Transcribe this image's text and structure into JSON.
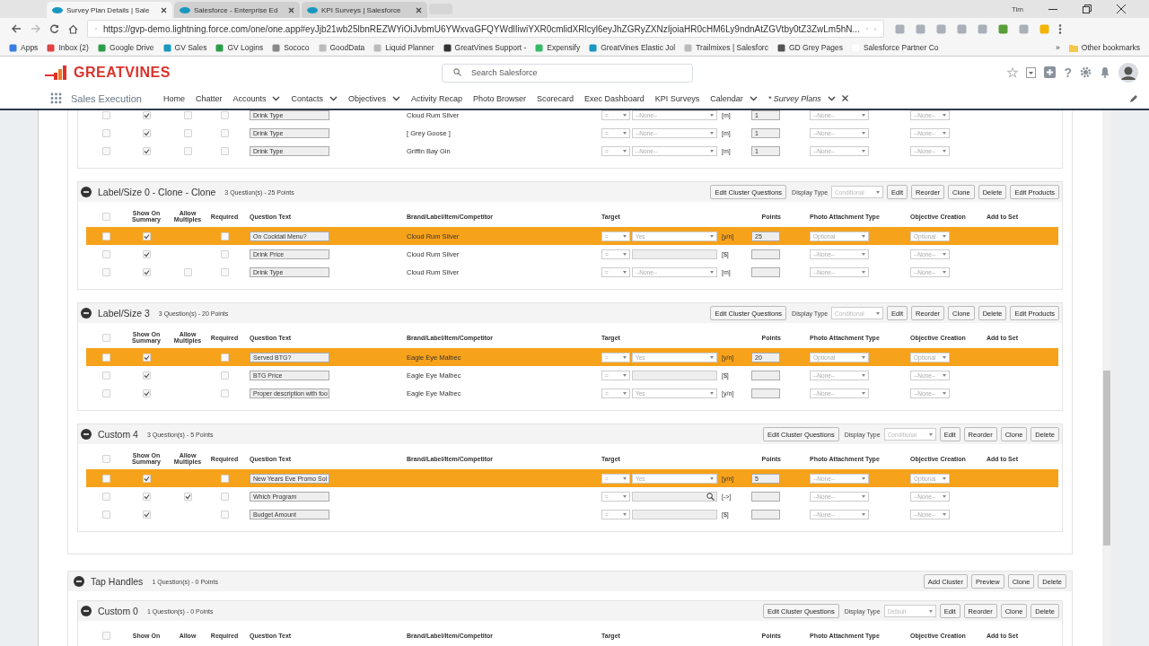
{
  "browser": {
    "tabs": [
      {
        "title": "Survey Plan Details | Sale",
        "selected": true
      },
      {
        "title": "Salesforce - Enterprise Ed",
        "selected": false
      },
      {
        "title": "KPI Surveys | Salesforce",
        "selected": false
      }
    ],
    "profile": "Tim",
    "url": "https://gvp-demo.lightning.force.com/one/one.app#eyJjb21wb25lbnREZWYiOiJvbmU6YWxvaGFQYWdlIiwiYXR0cmlidXRlcyl6eyJhZGRyZXNzIjoiaHR0cHM6Ly9ndnAtZGVtby0tZ3ZwLm5hN...",
    "bookmarks": [
      "Apps",
      "Inbox (2)",
      "Google Drive",
      "GV Sales",
      "GV Logins",
      "Sococo",
      "GoodData",
      "Liquid Planner",
      "GreatVines Support -",
      "Expensify",
      "GreatVines Elastic Jol",
      "Trailmixes | Salesforc",
      "GD Grey Pages",
      "Salesforce Partner Co"
    ],
    "more_bookmarks": "»",
    "other_bookmarks": "Other bookmarks"
  },
  "app": {
    "logo": "GREATVINES",
    "search": {
      "placeholder": "Search Salesforce"
    },
    "help": "?",
    "app_name": "Sales Execution",
    "nav": [
      {
        "label": "Home",
        "has_menu": false,
        "selected": false
      },
      {
        "label": "Chatter",
        "has_menu": false,
        "selected": false
      },
      {
        "label": "Accounts",
        "has_menu": true,
        "selected": false
      },
      {
        "label": "Contacts",
        "has_menu": true,
        "selected": false
      },
      {
        "label": "Objectives",
        "has_menu": true,
        "selected": false
      },
      {
        "label": "Activity Recap",
        "has_menu": false,
        "selected": false
      },
      {
        "label": "Photo Browser",
        "has_menu": false,
        "selected": false
      },
      {
        "label": "Scorecard",
        "has_menu": false,
        "selected": false
      },
      {
        "label": "Exec Dashboard",
        "has_menu": false,
        "selected": false
      },
      {
        "label": "KPI Surveys",
        "has_menu": false,
        "selected": false
      },
      {
        "label": "Calendar",
        "has_menu": true,
        "selected": false
      },
      {
        "label": "* Survey Plans",
        "has_menu": true,
        "selected": true
      }
    ]
  },
  "groups": [
    {
      "clusters": [
        {
          "rows": [
            {
              "highlighted": false,
              "show_on_summary": true,
              "allow_multiples": false,
              "required": false,
              "question": "Drink Type",
              "brand": "Cloud Rum Silver",
              "operator": "=",
              "kind": "select",
              "target_value": "--None--",
              "unit": "[m]",
              "points": "1",
              "photo": "--None--",
              "objective": "--None--"
            },
            {
              "highlighted": false,
              "show_on_summary": true,
              "allow_multiples": false,
              "required": false,
              "question": "Drink Type",
              "brand": "[ Grey Goose ]",
              "operator": "=",
              "kind": "select",
              "target_value": "--None--",
              "unit": "[m]",
              "points": "1",
              "photo": "--None--",
              "objective": "--None--"
            },
            {
              "highlighted": false,
              "show_on_summary": true,
              "allow_multiples": false,
              "required": false,
              "question": "Drink Type",
              "brand": "Griffin Bay Gin",
              "operator": "=",
              "kind": "select",
              "target_value": "--None--",
              "unit": "[m]",
              "points": "1",
              "photo": "--None--",
              "objective": "--None--"
            }
          ]
        },
        {
          "title": "Label/Size 0 - Clone - Clone",
          "summary": "3 Question(s) - 25 Points",
          "edit_button": "Edit Cluster Questions",
          "display_type": {
            "label": "Display Type",
            "value": "Conditional"
          },
          "buttons": [
            "Edit",
            "Reorder",
            "Clone",
            "Delete",
            "Edit Products"
          ],
          "all_selected": false,
          "columns": [
            "Show On Summary",
            "Allow Multiples",
            "Required",
            "Question Text",
            "Brand/Label/Item/Competitor",
            "Target",
            "Points",
            "Photo Attachment Type",
            "Objective Creation",
            "Add to Set"
          ],
          "rows": [
            {
              "highlighted": true,
              "show_on_summary": true,
              "required": false,
              "question": "On Cocktail Menu?",
              "brand": "Cloud Rum Silver",
              "operator": "=",
              "kind": "select",
              "target_value": "Yes",
              "unit": "[y/n]",
              "points": "25",
              "photo": "Optional",
              "objective": "Optional"
            },
            {
              "highlighted": false,
              "show_on_summary": true,
              "required": false,
              "question": "Drink Price",
              "brand": "Cloud Rum Silver",
              "operator": "=",
              "kind": "text",
              "unit": "[$]",
              "photo": "--None--",
              "objective": "--None--"
            },
            {
              "highlighted": false,
              "show_on_summary": true,
              "allow_multiples": false,
              "required": false,
              "question": "Drink Type",
              "brand": "Cloud Rum Silver",
              "operator": "=",
              "kind": "select",
              "target_value": "--None--",
              "unit": "[m]",
              "photo": "--None--",
              "objective": "--None--"
            }
          ]
        },
        {
          "title": "Label/Size 3",
          "summary": "3 Question(s) - 20 Points",
          "edit_button": "Edit Cluster Questions",
          "display_type": {
            "label": "Display Type",
            "value": "Conditional"
          },
          "buttons": [
            "Edit",
            "Reorder",
            "Clone",
            "Delete",
            "Edit Products"
          ],
          "all_selected": false,
          "columns": [
            "Show On Summary",
            "Allow Multiples",
            "Required",
            "Question Text",
            "Brand/Label/Item/Competitor",
            "Target",
            "Points",
            "Photo Attachment Type",
            "Objective Creation",
            "Add to Set"
          ],
          "rows": [
            {
              "highlighted": true,
              "show_on_summary": true,
              "required": false,
              "question": "Served BTG?",
              "brand": "Eagle Eye Malbec",
              "operator": "=",
              "kind": "select",
              "target_value": "Yes",
              "unit": "[y/n]",
              "points": "20",
              "photo": "Optional",
              "objective": "Optional"
            },
            {
              "highlighted": false,
              "show_on_summary": true,
              "required": false,
              "question": "BTG Price",
              "brand": "Eagle Eye Malbec",
              "operator": "=",
              "kind": "text",
              "unit": "[$]",
              "photo": "--None--",
              "objective": "--None--"
            },
            {
              "highlighted": false,
              "show_on_summary": true,
              "required": false,
              "question": "Proper description with foo",
              "brand": "Eagle Eye Malbec",
              "operator": "=",
              "kind": "select",
              "target_value": "Yes",
              "unit": "[y/n]",
              "photo": "--None--",
              "objective": "--None--"
            }
          ]
        },
        {
          "title": "Custom 4",
          "summary": "3 Question(s) - 5 Points",
          "edit_button": "Edit Cluster Questions",
          "display_type": {
            "label": "Display Type",
            "value": "Conditional"
          },
          "buttons": [
            "Edit",
            "Reorder",
            "Clone",
            "Delete"
          ],
          "all_selected": false,
          "columns": [
            "Show On Summary",
            "Allow Multiples",
            "Required",
            "Question Text",
            "Brand/Label/Item/Competitor",
            "Target",
            "Points",
            "Photo Attachment Type",
            "Objective Creation",
            "Add to Set"
          ],
          "rows": [
            {
              "highlighted": true,
              "show_on_summary": true,
              "required": false,
              "question": "New Years Eve Promo Sol",
              "operator": "=",
              "kind": "select",
              "target_value": "Yes",
              "unit": "[y/n]",
              "points": "5",
              "photo": "--None--",
              "objective": "Optional"
            },
            {
              "highlighted": false,
              "show_on_summary": true,
              "allow_multiples": true,
              "required": false,
              "question": "Which Program",
              "operator": "=",
              "kind": "lookup",
              "unit": "[->]",
              "photo": "--None--",
              "objective": "--None--"
            },
            {
              "highlighted": false,
              "show_on_summary": true,
              "required": false,
              "question": "Budget Amount",
              "operator": "=",
              "kind": "text",
              "unit": "[$]",
              "photo": "--None--",
              "objective": "--None--"
            }
          ]
        }
      ]
    },
    {
      "title": "Tap Handles",
      "summary": "1 Question(s) - 0 Points",
      "buttons": [
        "Add Cluster",
        "Preview",
        "Clone",
        "Delete"
      ],
      "clusters": [
        {
          "title": "Custom 0",
          "summary": "1 Question(s) - 0 Points",
          "edit_button": "Edit Cluster Questions",
          "display_type": {
            "label": "Display Type",
            "value": "Default"
          },
          "buttons": [
            "Edit",
            "Reorder",
            "Clone",
            "Delete"
          ],
          "all_selected": false,
          "columns": [
            "Show On",
            "Allow",
            "Required",
            "Question Text",
            "Brand/Label/Item/Competitor",
            "Target",
            "Points",
            "Photo Attachment Type",
            "Objective Creation",
            "Add to Set"
          ]
        }
      ]
    }
  ]
}
